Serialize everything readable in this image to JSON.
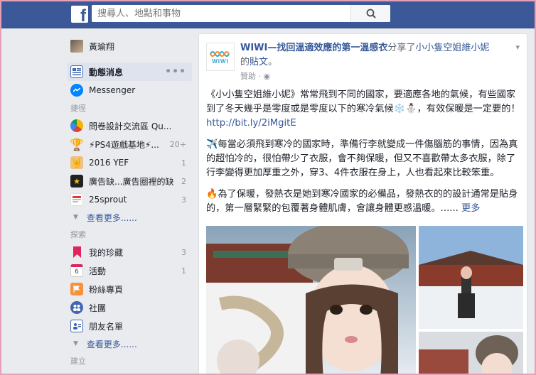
{
  "header": {
    "search_placeholder": "搜尋人、地點和事物",
    "brand_color": "#3b5998"
  },
  "user": {
    "name": "黃瑜翔"
  },
  "nav": {
    "main": [
      {
        "label": "動態消息",
        "icon": "news-feed-icon",
        "active": true
      },
      {
        "label": "Messenger",
        "icon": "messenger-icon"
      }
    ],
    "shortcuts_title": "捷徑",
    "shortcuts": [
      {
        "label": "問卷設計交流區 Qu...",
        "icon": "pie-chart-icon",
        "count": ""
      },
      {
        "label": "⚡PS4遊戲基地⚡...",
        "icon": "trophy-icon",
        "count": "20+"
      },
      {
        "label": "2016 YEF",
        "icon": "group-photo-icon",
        "count": "1"
      },
      {
        "label": "廣告缺...廣告圈裡的缺",
        "icon": "star-badge-icon",
        "count": "2"
      },
      {
        "label": "25sprout",
        "icon": "sprout-logo-icon",
        "count": "3"
      }
    ],
    "shortcuts_more": "查看更多......",
    "explore_title": "探索",
    "explore": [
      {
        "label": "我的珍藏",
        "icon": "bookmark-icon",
        "count": "3"
      },
      {
        "label": "活動",
        "icon": "calendar-icon",
        "count": "1",
        "date": "6"
      },
      {
        "label": "粉絲專頁",
        "icon": "flag-icon",
        "count": ""
      },
      {
        "label": "社團",
        "icon": "groups-icon",
        "count": ""
      },
      {
        "label": "朋友名單",
        "icon": "friends-list-icon",
        "count": ""
      }
    ],
    "explore_more": "查看更多......",
    "create_title": "建立"
  },
  "post": {
    "page_name": "WIWI—找回溫適效應的第一溫感衣",
    "shared_text": "分享了",
    "shared_from": "小小隻空姐維小妮",
    "shared_from_suffix": "的",
    "post_link": "貼文",
    "post_link_suffix": "。",
    "sponsored": "贊助",
    "avatar_word": "WIWI",
    "para1": "《小小隻空姐維小妮》常常飛到不同的國家，要適應各地的氣候，有些國家到了冬天幾乎是零度或是零度以下的寒冷氣候",
    "para1_emoji": "❄️⛄",
    "para1_tail": "，有效保暖是一定要的！",
    "url": "http://bit.ly/2iMgitE",
    "para2_emoji": "✈️",
    "para2": "每當必須飛到寒冷的國家時，準備行李就變成一件傷腦筋的事情，因為真的超怕冷的，很怕帶少了衣服，會不夠保暖，但又不喜歡帶太多衣服，除了行李變得更加厚重之外，穿3、4件衣服在身上，人也看起來比較笨重。",
    "para3_emoji": "🔥",
    "para3": "為了保暖，發熱衣是她到寒冷國家的必備品，發熱衣的的設計通常是貼身的，第一層緊緊的包覆著身體肌膚，會讓身體更感溫暖。......",
    "more": "更多"
  }
}
